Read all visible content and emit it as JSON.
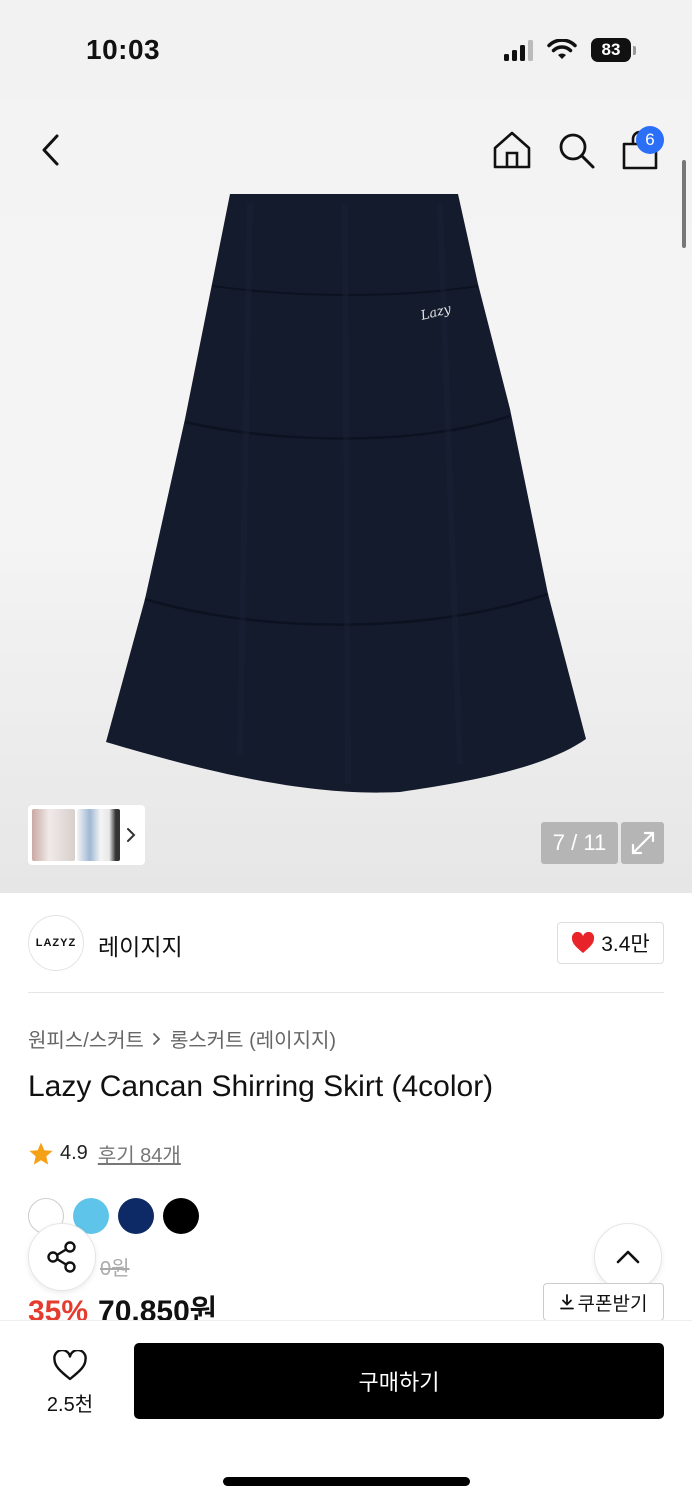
{
  "status_bar": {
    "time": "10:03",
    "battery": "83",
    "icons": [
      "signal-icon",
      "wifi-icon",
      "battery-icon"
    ]
  },
  "nav": {
    "icons": [
      "back-icon",
      "home-icon",
      "search-icon",
      "shopping-bag-icon"
    ],
    "cart_count": "6"
  },
  "gallery": {
    "image_logo_text": "Lazy",
    "page_current": "7",
    "page_total": "11",
    "page_separator": " / ",
    "thumbnail_icon": "chevron-right-icon",
    "expand_icon": "expand-icon"
  },
  "brand": {
    "logo_text": "LAZYZ",
    "name": "레이지지",
    "likes": "3.4만",
    "like_icon": "heart-filled-icon"
  },
  "product": {
    "breadcrumb": [
      "원피스/스커트",
      "롱스커트 (레이지지)"
    ],
    "title": "Lazy Cancan Shirring Skirt (4color)",
    "rating": "4.9",
    "reviews_label": "후기 84개",
    "colors": [
      {
        "name": "white",
        "hex": "#ffffff"
      },
      {
        "name": "sky blue",
        "hex": "#5ec4ea"
      },
      {
        "name": "navy",
        "hex": "#0d2a66"
      },
      {
        "name": "black",
        "hex": "#000000"
      }
    ],
    "original_price_partial": "0원",
    "discount": "35%",
    "sale_price": "70,850원",
    "coupon_label": "쿠폰받기"
  },
  "actions": {
    "wishlist_count": "2.5천",
    "buy_label": "구매하기",
    "share_icon": "share-icon",
    "scroll_top_icon": "chevron-up-icon",
    "download_icon": "download-icon"
  },
  "colors": {
    "accent_red": "#e43c2f",
    "badge_blue": "#2b6ff6",
    "buy_button": "#000000"
  }
}
